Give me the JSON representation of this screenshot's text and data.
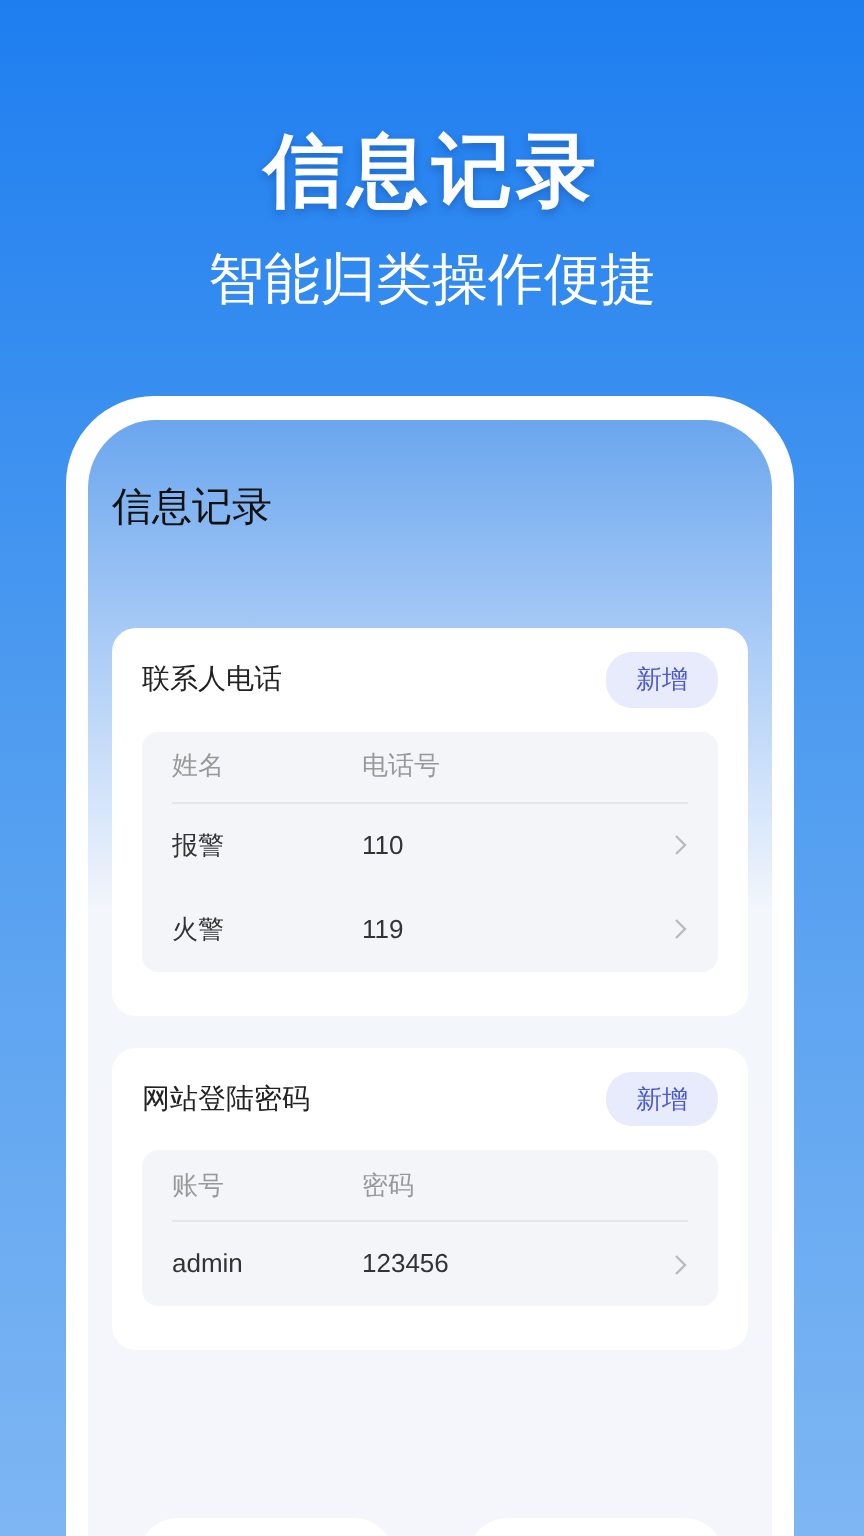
{
  "headline": "信息记录",
  "tagline": "智能归类操作便捷",
  "screen": {
    "title": "信息记录",
    "sections": [
      {
        "title": "联系人电话",
        "add_button": "新增",
        "columns": [
          "姓名",
          "电话号"
        ],
        "rows": [
          [
            "报警",
            "110"
          ],
          [
            "火警",
            "119"
          ]
        ]
      },
      {
        "title": "网站登陆密码",
        "add_button": "新增",
        "columns": [
          "账号",
          "密码"
        ],
        "rows": [
          [
            "admin",
            "123456"
          ]
        ]
      }
    ]
  }
}
